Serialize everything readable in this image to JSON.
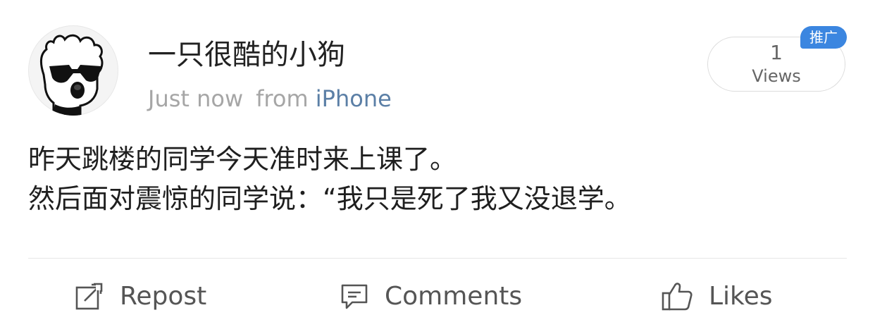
{
  "post": {
    "username": "一只很酷的小狗",
    "time": "Just now",
    "from_label": "from",
    "source": "iPhone",
    "views_count": "1",
    "views_label": "Views",
    "promo_badge": "推广",
    "content_lines": [
      "昨天跳楼的同学今天准时来上课了。",
      "然后面对震惊的同学说：“我只是死了我又没退学。"
    ]
  },
  "actions": {
    "repost": "Repost",
    "comments": "Comments",
    "likes": "Likes"
  },
  "icons": {
    "repost": "repost-icon",
    "comments": "comment-icon",
    "likes": "thumbs-up-icon",
    "avatar": "dog-with-sunglasses-avatar"
  },
  "colors": {
    "source_link": "#5b7fa6",
    "promo_badge": "#3b86e0",
    "meta_text": "#a6a6a6"
  }
}
